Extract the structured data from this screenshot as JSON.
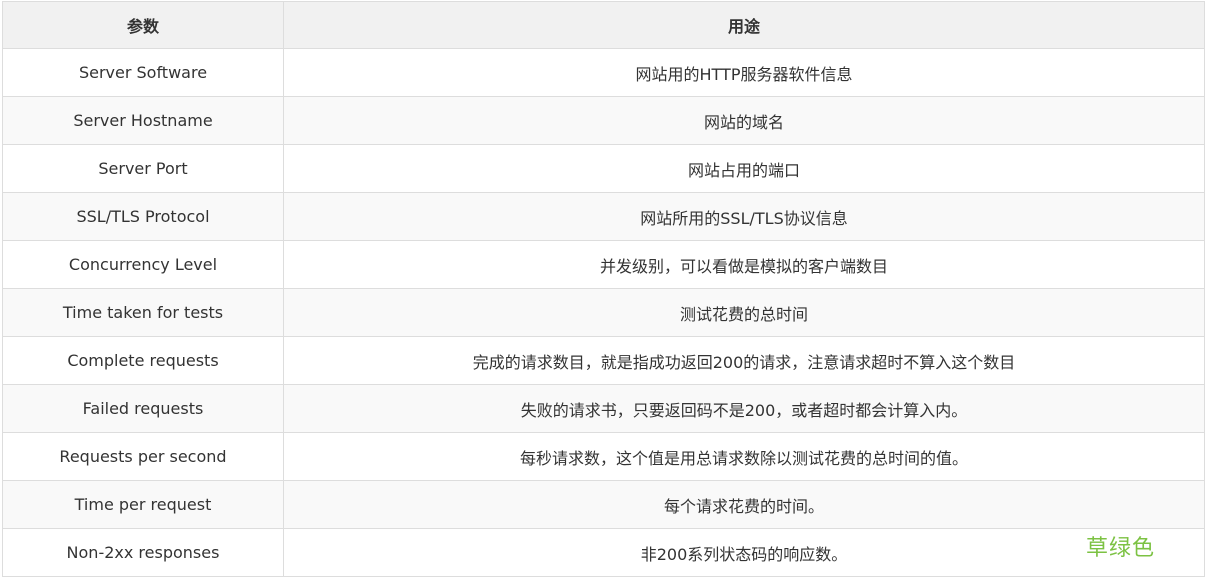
{
  "table": {
    "headers": [
      "参数",
      "用途"
    ],
    "rows": [
      [
        "Server Software",
        "网站用的HTTP服务器软件信息"
      ],
      [
        "Server Hostname",
        "网站的域名"
      ],
      [
        "Server Port",
        "网站占用的端口"
      ],
      [
        "SSL/TLS Protocol",
        "网站所用的SSL/TLS协议信息"
      ],
      [
        "Concurrency Level",
        "并发级别，可以看做是模拟的客户端数目"
      ],
      [
        "Time taken for tests",
        "测试花费的总时间"
      ],
      [
        "Complete requests",
        "完成的请求数目，就是指成功返回200的请求，注意请求超时不算入这个数目"
      ],
      [
        "Failed requests",
        "失败的请求书，只要返回码不是200，或者超时都会计算入内。"
      ],
      [
        "Requests per second",
        "每秒请求数，这个值是用总请求数除以测试花费的总时间的值。"
      ],
      [
        "Time per request",
        "每个请求花费的时间。"
      ],
      [
        "Non-2xx responses",
        "非200系列状态码的响应数。"
      ]
    ]
  },
  "watermark": {
    "text": "草绿色",
    "color": "#7cc243"
  },
  "colors": {
    "header_bg": "#f1f1f1",
    "stripe_bg": "#f9f9f9",
    "border": "#dddddd",
    "text": "#333333"
  }
}
